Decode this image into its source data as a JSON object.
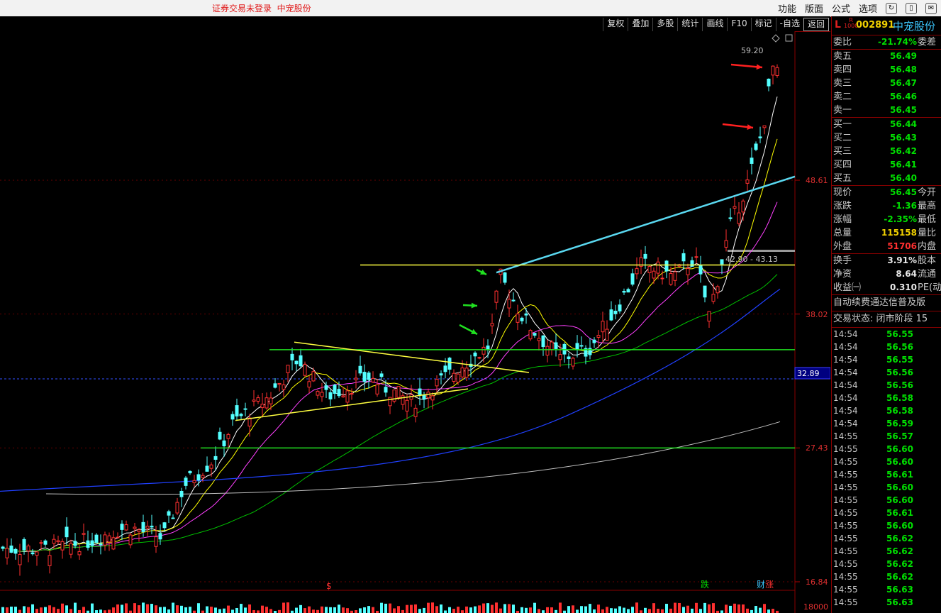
{
  "topbar": {
    "status": "证券交易未登录",
    "stock": "中宠股份",
    "menu": [
      "功能",
      "版面",
      "公式",
      "选项"
    ]
  },
  "toolbar": {
    "buttons": [
      "复权",
      "叠加",
      "多股",
      "统计",
      "画线",
      "F10",
      "标记",
      "-自选",
      "返回"
    ]
  },
  "chart": {
    "y_ticks": [
      "48.61",
      "38.02",
      "27.43",
      "16.84"
    ],
    "current_label": "32.89",
    "high_label": "59.20",
    "annotation": "42.90 - 43.13",
    "markers": [
      "$",
      "跌",
      "财",
      "涨"
    ],
    "volume_tick": "18000",
    "colors": {
      "up": "#ff3030",
      "down": "#54ffff",
      "ma5": "#ffffff",
      "ma10": "#ffff00",
      "ma20": "#ff40ff",
      "ma60": "#00c000",
      "ma120": "#2040ff",
      "ma250": "#c0c0c0",
      "trend": "#5ad8f0",
      "hline_yellow": "#ffff40",
      "hline_green": "#20e020"
    }
  },
  "side": {
    "logo": "L",
    "rank": [
      "R",
      "1000"
    ],
    "code": "002891",
    "name": "中宠股份",
    "weibi_label": "委比",
    "weibi_value": "-21.74%",
    "weicha_label": "委差",
    "sell": [
      {
        "label": "卖五",
        "price": "56.49"
      },
      {
        "label": "卖四",
        "price": "56.48"
      },
      {
        "label": "卖三",
        "price": "56.47"
      },
      {
        "label": "卖二",
        "price": "56.46"
      },
      {
        "label": "卖一",
        "price": "56.45"
      }
    ],
    "buy": [
      {
        "label": "买一",
        "price": "56.44"
      },
      {
        "label": "买二",
        "price": "56.43"
      },
      {
        "label": "买三",
        "price": "56.42"
      },
      {
        "label": "买四",
        "price": "56.41"
      },
      {
        "label": "买五",
        "price": "56.40"
      }
    ],
    "quote": [
      {
        "label": "现价",
        "value": "56.45",
        "label2": "今开",
        "color": "#00e000"
      },
      {
        "label": "涨跌",
        "value": "-1.36",
        "label2": "最高",
        "color": "#00e000"
      },
      {
        "label": "涨幅",
        "value": "-2.35%",
        "label2": "最低",
        "color": "#00e000"
      },
      {
        "label": "总量",
        "value": "115158",
        "label2": "量比",
        "color": "#f0d000"
      },
      {
        "label": "外盘",
        "value": "51706",
        "label2": "内盘",
        "color": "#ff3030"
      }
    ],
    "info": [
      {
        "label": "换手",
        "value": "3.91%",
        "label2": "股本"
      },
      {
        "label": "净资",
        "value": "8.64",
        "label2": "流通"
      },
      {
        "label": "收益㈠",
        "value": "0.310",
        "label2": "PE(动"
      }
    ],
    "notice": "自动续费通达信普及版",
    "trade_status": "交易状态: 闭市阶段 15",
    "ticks": [
      {
        "time": "14:54",
        "price": "56.55"
      },
      {
        "time": "14:54",
        "price": "56.56"
      },
      {
        "time": "14:54",
        "price": "56.55"
      },
      {
        "time": "14:54",
        "price": "56.56"
      },
      {
        "time": "14:54",
        "price": "56.56"
      },
      {
        "time": "14:54",
        "price": "56.58"
      },
      {
        "time": "14:54",
        "price": "56.58"
      },
      {
        "time": "14:54",
        "price": "56.59"
      },
      {
        "time": "14:55",
        "price": "56.57"
      },
      {
        "time": "14:55",
        "price": "56.60"
      },
      {
        "time": "14:55",
        "price": "56.60"
      },
      {
        "time": "14:55",
        "price": "56.61"
      },
      {
        "time": "14:55",
        "price": "56.60"
      },
      {
        "time": "14:55",
        "price": "56.60"
      },
      {
        "time": "14:55",
        "price": "56.61"
      },
      {
        "time": "14:55",
        "price": "56.60"
      },
      {
        "time": "14:55",
        "price": "56.62"
      },
      {
        "time": "14:55",
        "price": "56.62"
      },
      {
        "time": "14:55",
        "price": "56.62"
      },
      {
        "time": "14:55",
        "price": "56.62"
      },
      {
        "time": "14:55",
        "price": "56.63"
      },
      {
        "time": "14:55",
        "price": "56.63"
      }
    ]
  }
}
